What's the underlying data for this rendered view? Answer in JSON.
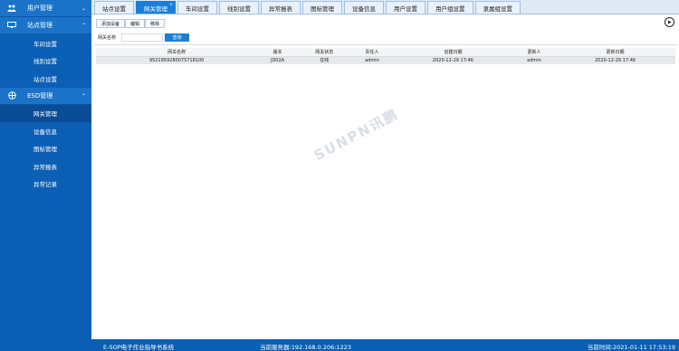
{
  "sidebar": {
    "groups": [
      {
        "title": "用户管理",
        "icon": "users-icon",
        "items": []
      },
      {
        "title": "站点管理",
        "icon": "monitor-icon",
        "items": [
          "车间设置",
          "线别设置",
          "站点设置"
        ]
      },
      {
        "title": "ESD管理",
        "icon": "globe-icon",
        "items": [
          "网关管理",
          "设备信息",
          "图标管理",
          "异常报表",
          "异常记录"
        ]
      }
    ],
    "active_item": "网关管理"
  },
  "tabs": [
    "站点设置",
    "网关管理",
    "车间设置",
    "线别设置",
    "异常报表",
    "图标管理",
    "设备信息",
    "用户设置",
    "用户组设置",
    "隶属组设置"
  ],
  "active_tab": "网关管理",
  "toolbar": {
    "add": "添加设备",
    "edit": "编辑",
    "delete": "移除"
  },
  "search": {
    "label": "网关名称",
    "value": "",
    "button": "查询"
  },
  "table": {
    "columns": [
      "网关名称",
      "版本",
      "网关状态",
      "责任人",
      "创建日期",
      "更新人",
      "更新日期"
    ],
    "rows": [
      [
        "9521959280075718100",
        "JD02A",
        "在线",
        "admin",
        "2020-12-29 17:46",
        "admin",
        "2020-12-29 17:46"
      ]
    ]
  },
  "watermark": "SUNPN讯鹏",
  "status": {
    "system": "E-SOP电子作业指导书系统",
    "server": "当前服务器:192.168.0.206:1223",
    "time": "当前时间:2021-01-11 17:53:19"
  }
}
